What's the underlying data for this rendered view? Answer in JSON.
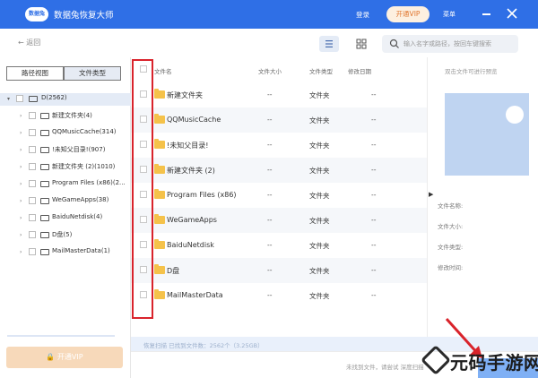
{
  "titlebar": {
    "logo_text": "数据兔",
    "app_title": "数据兔恢复大师",
    "login": "登录",
    "vip": "开通VIP",
    "menu": "菜单"
  },
  "toolbar": {
    "back": "返回",
    "search_placeholder": "输入名字或路径，按回车键搜索"
  },
  "sidebar": {
    "tabs": [
      "路径视图",
      "文件类型"
    ],
    "root": "D(2562)",
    "items": [
      {
        "label": "新建文件夹(4)"
      },
      {
        "label": "QQMusicCache(314)"
      },
      {
        "label": "!未知父目录!(907)"
      },
      {
        "label": "新建文件夹 (2)(1010)"
      },
      {
        "label": "Program Files (x86)(2..."
      },
      {
        "label": "WeGameApps(38)"
      },
      {
        "label": "BaiduNetdisk(4)"
      },
      {
        "label": "D盘(5)"
      },
      {
        "label": "MailMasterData(1)"
      }
    ],
    "vip_button": "开通VIP"
  },
  "filelist": {
    "columns": [
      "文件名",
      "文件大小",
      "文件类型",
      "修改日期"
    ],
    "rows": [
      {
        "name": "新建文件夹",
        "size": "--",
        "type": "文件夹",
        "modified": "--"
      },
      {
        "name": "QQMusicCache",
        "size": "--",
        "type": "文件夹",
        "modified": "--"
      },
      {
        "name": "!未知父目录!",
        "size": "--",
        "type": "文件夹",
        "modified": "--"
      },
      {
        "name": "新建文件夹 (2)",
        "size": "--",
        "type": "文件夹",
        "modified": "--"
      },
      {
        "name": "Program Files (x86)",
        "size": "--",
        "type": "文件夹",
        "modified": "--"
      },
      {
        "name": "WeGameApps",
        "size": "--",
        "type": "文件夹",
        "modified": "--"
      },
      {
        "name": "BaiduNetdisk",
        "size": "--",
        "type": "文件夹",
        "modified": "--"
      },
      {
        "name": "D盘",
        "size": "--",
        "type": "文件夹",
        "modified": "--"
      },
      {
        "name": "MailMasterData",
        "size": "--",
        "type": "文件夹",
        "modified": "--"
      }
    ]
  },
  "preview": {
    "hint": "双击文件可进行预览",
    "fields": [
      "文件名称:",
      "文件大小:",
      "文件类型:",
      "修改时间:"
    ]
  },
  "status": {
    "scan_text": "恢复扫描  已找到文件数：2562个（3.25GB）",
    "bottom_text": "未找到文件，请尝试 深度扫描"
  },
  "watermark": "元码手游网",
  "colors": {
    "brand_blue": "#2f6fe6",
    "highlight_red": "#d9232b",
    "folder_yellow": "#f5c24a",
    "vip_orange": "#e0742c"
  }
}
